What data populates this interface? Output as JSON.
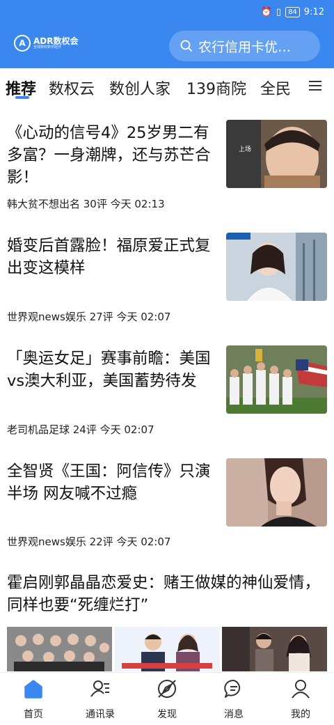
{
  "status": {
    "time": "9:12",
    "battery": "84"
  },
  "header": {
    "logo_text": "ADR数权会",
    "logo_subtext": "全球数权数字经济",
    "search_placeholder": "农行信用卡优…"
  },
  "tabs": [
    "推荐",
    "数权云",
    "数创人家",
    "139商院",
    "全民"
  ],
  "articles": [
    {
      "title": "《心动的信号4》25岁男二有多富？一身潮牌，还与苏芒合影！",
      "meta": "韩大贫不想出名 30评 今天 02:13"
    },
    {
      "title": "婚变后首露脸！福原爱正式复出变这模样",
      "meta": "世界观news娱乐 27评 今天 02:07"
    },
    {
      "title": "「奥运女足」赛事前瞻：美国vs澳大利亚，美国蓄势待发",
      "meta": "老司机品足球 24评 今天 02:07"
    },
    {
      "title": "全智贤《王国：阿信传》只演半场 网友喊不过瘾",
      "meta": "世界观news娱乐 22评 今天 02:07"
    },
    {
      "title": "霍启刚郭晶晶恋爱史：赌王做媒的神仙爱情，同样也要“死缠烂打”"
    }
  ],
  "nav": [
    {
      "label": "首页",
      "icon": "home-icon"
    },
    {
      "label": "通讯录",
      "icon": "contacts-icon"
    },
    {
      "label": "发现",
      "icon": "discover-icon"
    },
    {
      "label": "消息",
      "icon": "message-icon"
    },
    {
      "label": "我的",
      "icon": "profile-icon"
    }
  ],
  "colors": {
    "brand": "#3a87ef",
    "tab_indicator": "#3a87ef"
  }
}
